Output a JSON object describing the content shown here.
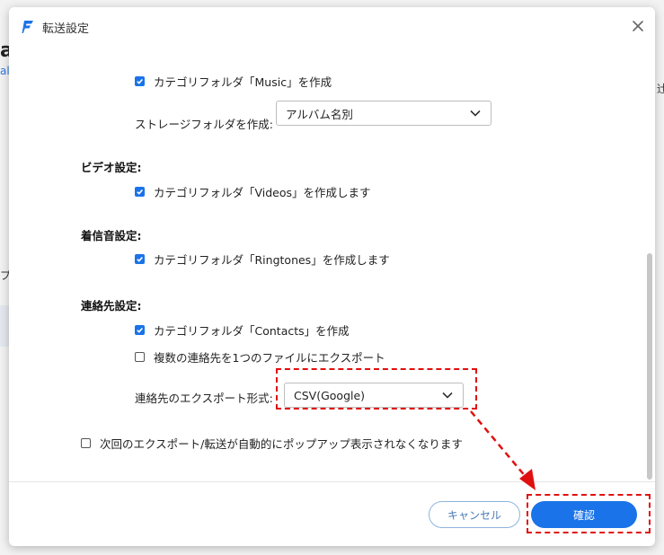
{
  "background": {
    "fragment_big": "a",
    "fragment_small": "al",
    "fragment_right": "辻",
    "fragment_left": "プ"
  },
  "dialog": {
    "title": "転送設定",
    "music": {
      "create_folder": "カテゴリフォルダ「Music」を作成",
      "storage_label": "ストレージフォルダを作成:",
      "storage_value": "アルバム名別"
    },
    "video": {
      "section_title": "ビデオ設定:",
      "create_folder": "カテゴリフォルダ「Videos」を作成します"
    },
    "ringtone": {
      "section_title": "着信音設定:",
      "create_folder": "カテゴリフォルダ「Ringtones」を作成します"
    },
    "contacts": {
      "section_title": "連絡先設定:",
      "create_folder": "カテゴリフォルダ「Contacts」を作成",
      "export_multiple": "複数の連絡先を1つのファイルにエクスポート",
      "export_format_label": "連絡先のエクスポート形式:",
      "export_format_value": "CSV(Google)"
    },
    "no_popup": "次回のエクスポート/転送が自動的にポップアップ表示されなくなります",
    "cancel_label": "キャンセル",
    "ok_label": "確認"
  },
  "colors": {
    "accent": "#1a73e8",
    "highlight": "#e01010"
  }
}
